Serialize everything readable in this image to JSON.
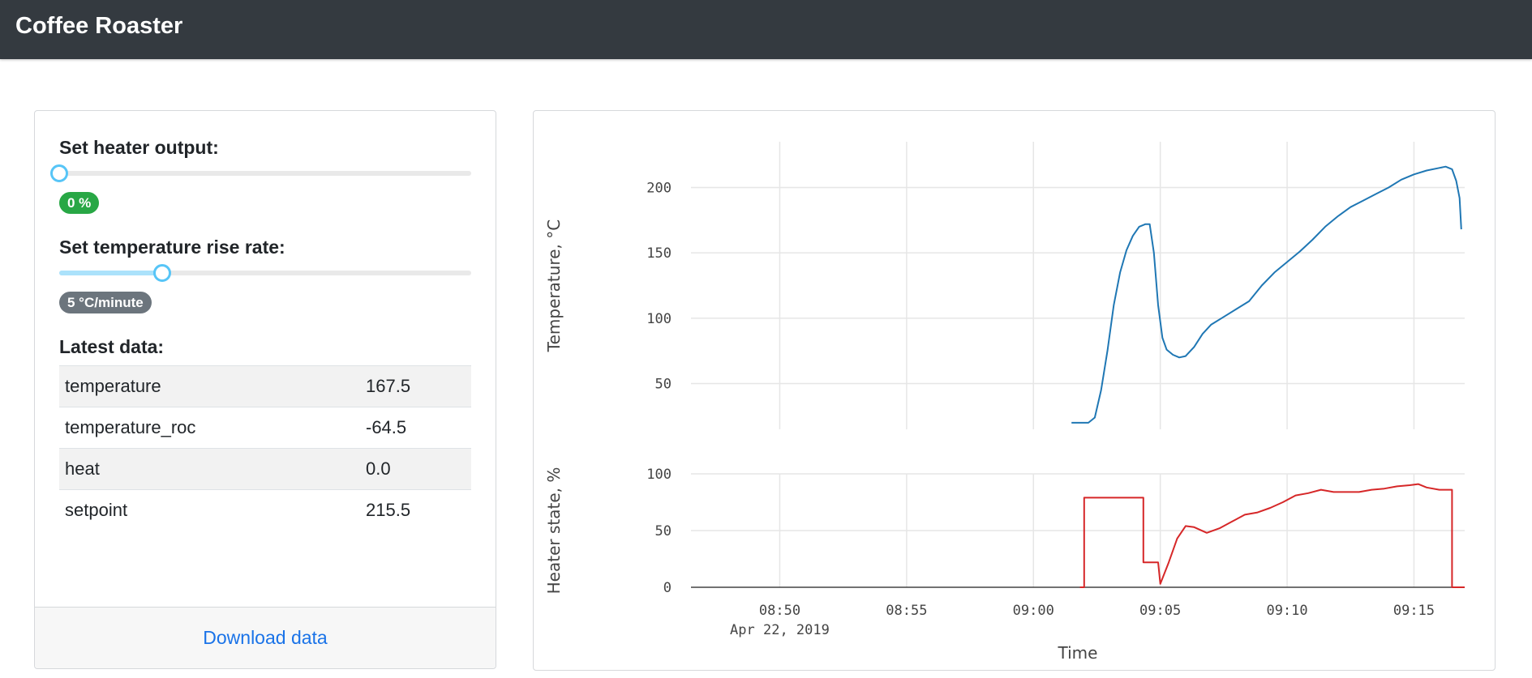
{
  "app": {
    "title": "Coffee Roaster"
  },
  "controls": {
    "heater": {
      "label": "Set heater output:",
      "value": 0,
      "max": 100,
      "badge": "0 %"
    },
    "rise_rate": {
      "label": "Set temperature rise rate:",
      "value": 5,
      "max": 20,
      "badge": "5 °C/minute"
    },
    "latest_title": "Latest data:",
    "latest_rows": [
      {
        "key": "temperature",
        "value": "167.5"
      },
      {
        "key": "temperature_roc",
        "value": "-64.5"
      },
      {
        "key": "heat",
        "value": "0.0"
      },
      {
        "key": "setpoint",
        "value": "215.5"
      }
    ],
    "download_label": "Download data"
  },
  "colors": {
    "temperature": "#1f77b4",
    "heater": "#d62728",
    "badge_green": "#28a745",
    "badge_gray": "#6c757d"
  },
  "chart_data": [
    {
      "type": "line",
      "name": "temperature",
      "ylabel": "Temperature, °C",
      "ylim": [
        15,
        235
      ],
      "xlim": [
        "08:46:30",
        "09:17:00"
      ],
      "yticks": [
        50,
        100,
        150,
        200
      ],
      "grid": true,
      "series": [
        {
          "points": [
            [
              "09:01:30",
              20
            ],
            [
              "09:02:10",
              20
            ],
            [
              "09:02:25",
              24
            ],
            [
              "09:02:40",
              45
            ],
            [
              "09:02:55",
              75
            ],
            [
              "09:03:10",
              110
            ],
            [
              "09:03:25",
              135
            ],
            [
              "09:03:40",
              152
            ],
            [
              "09:03:55",
              163
            ],
            [
              "09:04:10",
              170
            ],
            [
              "09:04:25",
              172
            ],
            [
              "09:04:35",
              172
            ],
            [
              "09:04:45",
              150
            ],
            [
              "09:04:55",
              110
            ],
            [
              "09:05:05",
              85
            ],
            [
              "09:05:15",
              76
            ],
            [
              "09:05:30",
              72
            ],
            [
              "09:05:45",
              70
            ],
            [
              "09:06:00",
              71
            ],
            [
              "09:06:20",
              78
            ],
            [
              "09:06:40",
              88
            ],
            [
              "09:07:00",
              95
            ],
            [
              "09:07:30",
              101
            ],
            [
              "09:08:00",
              107
            ],
            [
              "09:08:30",
              113
            ],
            [
              "09:09:00",
              125
            ],
            [
              "09:09:30",
              135
            ],
            [
              "09:10:00",
              143
            ],
            [
              "09:10:30",
              151
            ],
            [
              "09:11:00",
              160
            ],
            [
              "09:11:30",
              170
            ],
            [
              "09:12:00",
              178
            ],
            [
              "09:12:30",
              185
            ],
            [
              "09:13:00",
              190
            ],
            [
              "09:13:30",
              195
            ],
            [
              "09:14:00",
              200
            ],
            [
              "09:14:30",
              206
            ],
            [
              "09:15:00",
              210
            ],
            [
              "09:15:30",
              213
            ],
            [
              "09:16:00",
              215
            ],
            [
              "09:16:15",
              216
            ],
            [
              "09:16:30",
              214
            ],
            [
              "09:16:40",
              205
            ],
            [
              "09:16:48",
              192
            ],
            [
              "09:16:52",
              168
            ]
          ]
        }
      ]
    },
    {
      "type": "line",
      "name": "heater",
      "ylabel": "Heater state, %",
      "xlabel": "Time",
      "ylim": [
        0,
        100
      ],
      "yticks": [
        0,
        50,
        100
      ],
      "xlim": [
        "08:46:30",
        "09:17:00"
      ],
      "xticks": [
        "08:50",
        "08:55",
        "09:00",
        "09:05",
        "09:10",
        "09:15"
      ],
      "xtick_sublabel": "Apr 22, 2019",
      "grid": true,
      "series": [
        {
          "points": [
            [
              "09:01:50",
              0
            ],
            [
              "09:02:00",
              0
            ],
            [
              "09:02:00",
              79
            ],
            [
              "09:04:20",
              79
            ],
            [
              "09:04:20",
              22
            ],
            [
              "09:04:55",
              22
            ],
            [
              "09:05:00",
              3
            ],
            [
              "09:05:20",
              22
            ],
            [
              "09:05:40",
              43
            ],
            [
              "09:06:00",
              54
            ],
            [
              "09:06:20",
              53
            ],
            [
              "09:06:50",
              48
            ],
            [
              "09:07:20",
              52
            ],
            [
              "09:07:50",
              58
            ],
            [
              "09:08:20",
              64
            ],
            [
              "09:08:50",
              66
            ],
            [
              "09:09:20",
              70
            ],
            [
              "09:09:50",
              75
            ],
            [
              "09:10:20",
              81
            ],
            [
              "09:10:50",
              83
            ],
            [
              "09:11:20",
              86
            ],
            [
              "09:11:50",
              84
            ],
            [
              "09:12:20",
              84
            ],
            [
              "09:12:50",
              84
            ],
            [
              "09:13:20",
              86
            ],
            [
              "09:13:50",
              87
            ],
            [
              "09:14:20",
              89
            ],
            [
              "09:14:50",
              90
            ],
            [
              "09:15:10",
              91
            ],
            [
              "09:15:30",
              88
            ],
            [
              "09:16:00",
              86
            ],
            [
              "09:16:30",
              86
            ],
            [
              "09:16:30",
              0
            ],
            [
              "09:17:00",
              0
            ]
          ]
        }
      ]
    }
  ]
}
